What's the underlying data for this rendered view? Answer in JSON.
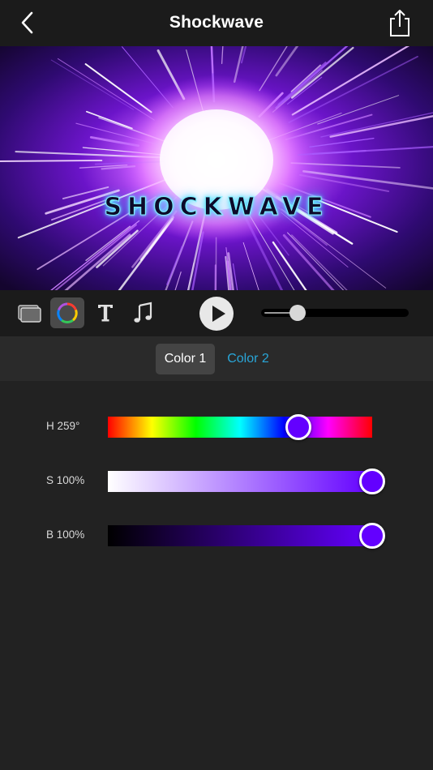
{
  "navbar": {
    "title": "Shockwave",
    "back_icon": "chevron-left-icon",
    "share_icon": "share-icon"
  },
  "preview": {
    "overlay_text": "SHOCKWAVE"
  },
  "toolbar": {
    "tools": [
      "layers-icon",
      "color-wheel-icon",
      "text-icon",
      "music-note-icon"
    ],
    "active_tool": "color-wheel-icon",
    "play_icon": "play-icon",
    "playback_position": 0.2
  },
  "color_tabs": {
    "items": [
      {
        "label": "Color 1",
        "selected": true
      },
      {
        "label": "Color 2",
        "selected": false
      }
    ]
  },
  "sliders": [
    {
      "key": "hue",
      "label": "H 259°",
      "value": 259,
      "max": 360
    },
    {
      "key": "saturation",
      "label": "S 100%",
      "value": 100,
      "max": 100
    },
    {
      "key": "brightness",
      "label": "B 100%",
      "value": 100,
      "max": 100
    }
  ],
  "colors": {
    "selected_color": "#6300ff",
    "accent_tab": "#29a6d8",
    "background": "#222222"
  }
}
